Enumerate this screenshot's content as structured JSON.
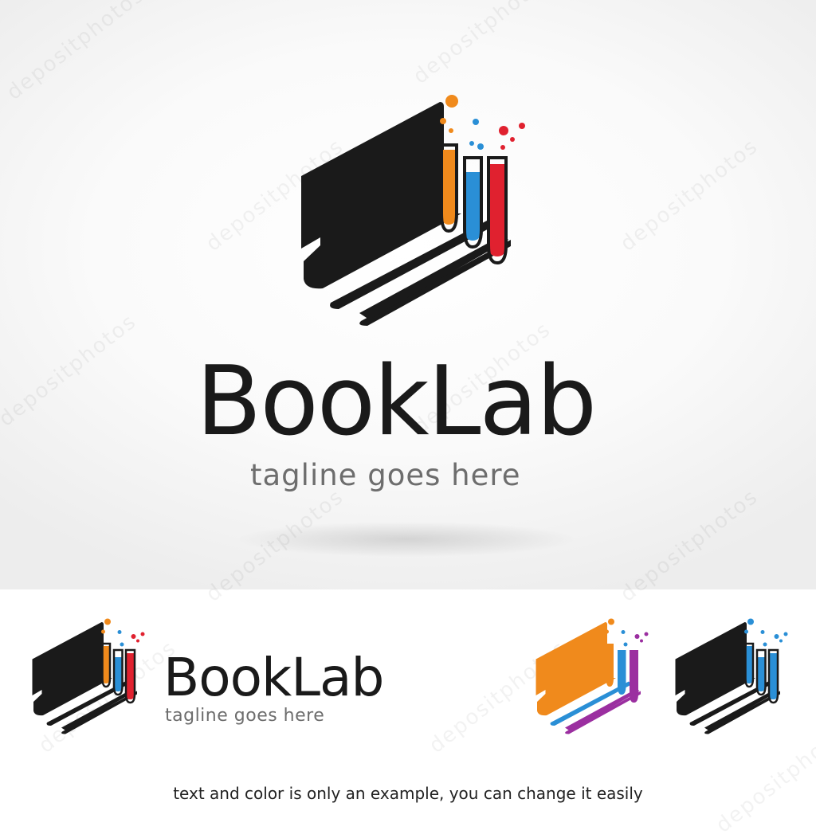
{
  "brand": {
    "name_part1": "Book",
    "name_part2": "Lab",
    "tagline": "tagline goes here"
  },
  "footer_note": "text and color is only an example, you can change it easily",
  "watermark_text": "depositphotos",
  "colors": {
    "ink": "#1a1a1a",
    "tagline_gray": "#6d6d6d",
    "orange": "#f08a1c",
    "blue": "#2a8fd6",
    "red": "#e0212f",
    "purple": "#9b2fa0",
    "hero_bg_edge": "#ededed",
    "white": "#ffffff"
  },
  "icons": [
    "book-lab-logo-icon",
    "book-lab-logo-small-icon",
    "book-lab-logo-orange-variant-icon",
    "book-lab-logo-blue-variant-icon"
  ]
}
